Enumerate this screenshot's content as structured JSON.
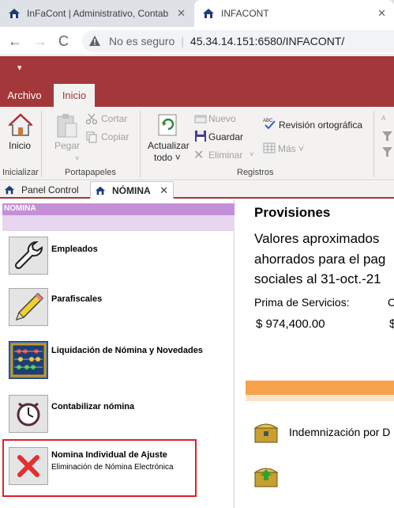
{
  "browser": {
    "tabs": [
      {
        "title": "InFaCont | Administrativo, Contab"
      },
      {
        "title": "INFACONT"
      }
    ],
    "nav": {
      "back": "←",
      "forward": "→",
      "reload": "C"
    },
    "address": {
      "security_label": "No es seguro",
      "separator": "|",
      "url": "45.34.14.151:6580/INFACONT/"
    },
    "close_glyph": "✕"
  },
  "ribbon": {
    "quick_access_glyph": "▾",
    "tabs": [
      {
        "label": "Archivo"
      },
      {
        "label": "Inicio"
      }
    ],
    "groups": {
      "inicializar": {
        "name": "Inicializar",
        "inicio_label": "Inicio"
      },
      "portapapeles": {
        "name": "Portapapeles",
        "pegar_label": "Pegar",
        "cortar_label": "Cortar",
        "copiar_label": "Copiar"
      },
      "registros": {
        "name": "Registros",
        "actualizar_label": "Actualizar",
        "todo_label": "todo ˅",
        "nuevo_label": "Nuevo",
        "guardar_label": "Guardar",
        "eliminar_label": "Eliminar",
        "revision_label": "Revisión ortográfica",
        "mas_label": "Más ˅"
      }
    },
    "accent": "#a4373a"
  },
  "doc_tabs": [
    {
      "label": "Panel Control"
    },
    {
      "label": "NÓMINA"
    }
  ],
  "left_panel": {
    "header": "NOMINA",
    "items": [
      {
        "title": "Empleados",
        "subtitle": "",
        "icon": "wrench-icon"
      },
      {
        "title": "Parafiscales",
        "subtitle": "",
        "icon": "pencil-icon"
      },
      {
        "title": "Liquidación de Nómina y Novedades",
        "subtitle": "",
        "icon": "abacus-icon"
      },
      {
        "title": "Contabilizar nómina",
        "subtitle": "",
        "icon": "clock-icon"
      },
      {
        "title": "Nomina Individual de Ajuste",
        "subtitle": "Eliminación de Nómina Electrónica",
        "icon": "red-x-icon"
      }
    ],
    "highlight_color": "#e0202a"
  },
  "right_panel": {
    "title": "Provisiones",
    "text_lines": [
      "Valores aproximados",
      "ahorrados para el pag",
      "sociales al  31-oct.-21"
    ],
    "prima_label": "Prima de Servicios:",
    "prima_value": "$ 974,400.00",
    "col2_label": "C",
    "col2_value": "$",
    "orange_color": "#f5a24a",
    "items": [
      {
        "label": "Indemnización por D",
        "icon": "chest-icon"
      },
      {
        "label": "",
        "icon": "chest-green-icon"
      }
    ]
  }
}
